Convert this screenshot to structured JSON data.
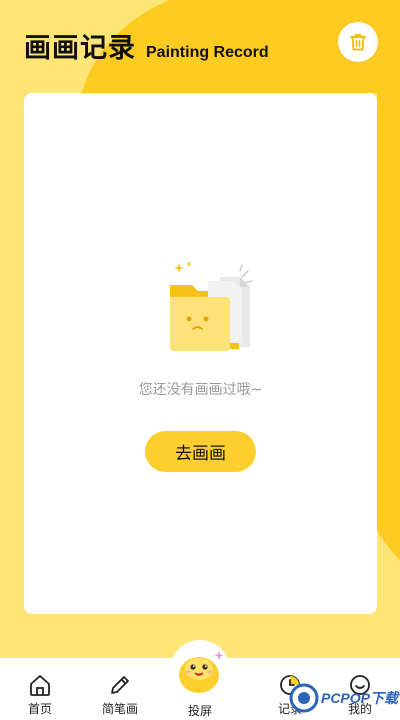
{
  "header": {
    "title_cn": "画画记录",
    "title_en": "Painting Record"
  },
  "toolbar": {
    "delete_icon": "trash-icon"
  },
  "empty_state": {
    "illustration": "empty-folder-illustration",
    "message": "您还没有画画过哦~",
    "action_label": "去画画"
  },
  "tabbar": {
    "items": [
      {
        "label": "首页",
        "icon": "home-icon"
      },
      {
        "label": "简笔画",
        "icon": "pencil-icon"
      },
      {
        "label": "投屏",
        "icon": "cast-mascot-icon"
      },
      {
        "label": "记录",
        "icon": "clock-icon"
      },
      {
        "label": "我的",
        "icon": "profile-icon"
      }
    ]
  },
  "watermark": {
    "text": "PCPOP下载"
  },
  "colors": {
    "background_light": "#ffe476",
    "background_dark": "#fdcb22",
    "accent": "#fdcf2e",
    "card": "#ffffff"
  }
}
